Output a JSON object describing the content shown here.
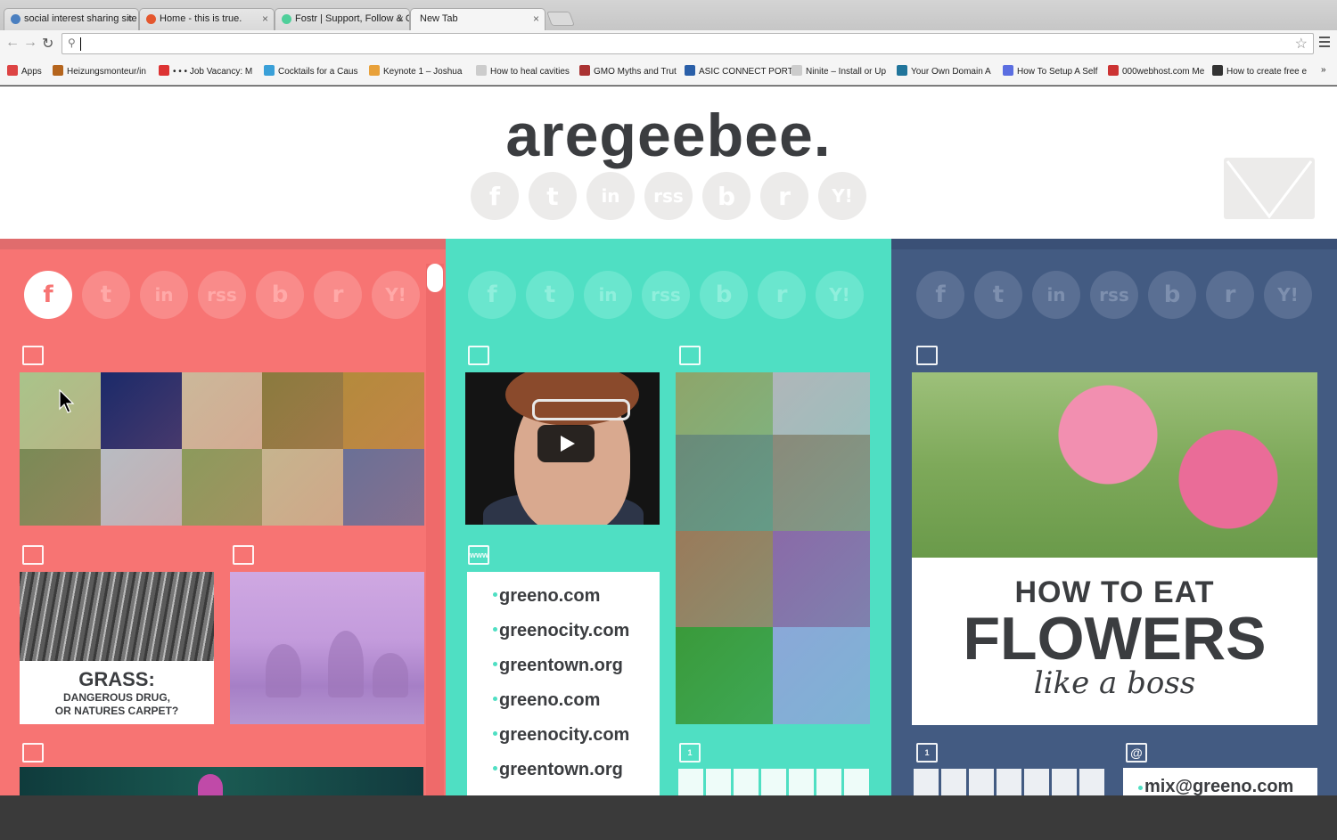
{
  "browser": {
    "tabs": [
      {
        "title": "social interest sharing site",
        "favicon_color": "#4a7fc0",
        "active": false
      },
      {
        "title": "Home - this is true.",
        "favicon_color": "#e4572e",
        "active": false
      },
      {
        "title": "Fostr | Support, Follow & C",
        "favicon_color": "#4fcf9a",
        "active": false
      },
      {
        "title": "New Tab",
        "favicon_color": "",
        "active": true
      }
    ],
    "close_glyph": "×",
    "omnibox_value": "",
    "bookmarks": [
      {
        "label": "Apps",
        "icon": "apps-grid-icon",
        "color": "#d44"
      },
      {
        "label": "Heizungsmonteur/in",
        "icon": "favicon",
        "color": "#b5651d"
      },
      {
        "label": "• • • Job Vacancy: M",
        "icon": "favicon",
        "color": "#d33"
      },
      {
        "label": "Cocktails for a Caus",
        "icon": "favicon",
        "color": "#3aa0d8"
      },
      {
        "label": "Keynote 1 – Joshua",
        "icon": "favicon",
        "color": "#e8a13a"
      },
      {
        "label": "How to heal cavities",
        "icon": "page-icon",
        "color": "#ccc"
      },
      {
        "label": "GMO Myths and Trut",
        "icon": "favicon",
        "color": "#a33"
      },
      {
        "label": "ASIC CONNECT PORT",
        "icon": "favicon",
        "color": "#2a5fa8"
      },
      {
        "label": "Ninite – Install or Up",
        "icon": "page-icon",
        "color": "#ccc"
      },
      {
        "label": "Your Own Domain A",
        "icon": "wordpress-icon",
        "color": "#21759b"
      },
      {
        "label": "How To Setup A Self",
        "icon": "favicon",
        "color": "#5b6ee1"
      },
      {
        "label": "000webhost.com Me",
        "icon": "favicon",
        "color": "#c33"
      },
      {
        "label": "How to create free e",
        "icon": "favicon",
        "color": "#333"
      }
    ],
    "bookmarks_overflow": "»"
  },
  "site": {
    "logo": "aregeebee.",
    "social_glyphs": [
      "f",
      "t",
      "in",
      "rss",
      "b",
      "r",
      "Y!"
    ],
    "social_names": [
      "facebook",
      "twitter",
      "linkedin",
      "rss",
      "bebo",
      "reddit",
      "yahoo"
    ]
  },
  "columns": {
    "c1": {
      "color": "#f77473",
      "active_social": "facebook",
      "grass_card": {
        "title": "GRASS:",
        "subtitle_line1": "DANGEROUS DRUG,",
        "subtitle_line2": "OR NATURES CARPET?"
      }
    },
    "c2": {
      "color": "#4fdfc3",
      "www_label": "www",
      "links": [
        "greeno.com",
        "greenocity.com",
        "greentown.org",
        "greeno.com",
        "greenocity.com",
        "greentown.org"
      ],
      "calendar_day": "1"
    },
    "c3": {
      "color": "#435b82",
      "flower_card": {
        "line1": "HOW TO EAT",
        "line2": "FLOWERS",
        "line3": "like a boss"
      },
      "calendar_day": "1",
      "email_icon": "@",
      "email": "mix@greeno.com"
    }
  },
  "photo_tiles_c1": [
    "#a9c48a",
    "#1b2a6a",
    "#cbb89a",
    "#8a7a3e",
    "#b48a3c",
    "#7a8a56",
    "#b8bcc2",
    "#8c9a5c",
    "#c6b48e",
    "#6a7096"
  ],
  "photo_tiles_c2": [
    "#8ea56a",
    "#b0b6ba",
    "#6a8a78",
    "#8a8a7a",
    "#9a7a5a",
    "#8a6aa8",
    "#3a9a3a",
    "#8aa8d8"
  ]
}
